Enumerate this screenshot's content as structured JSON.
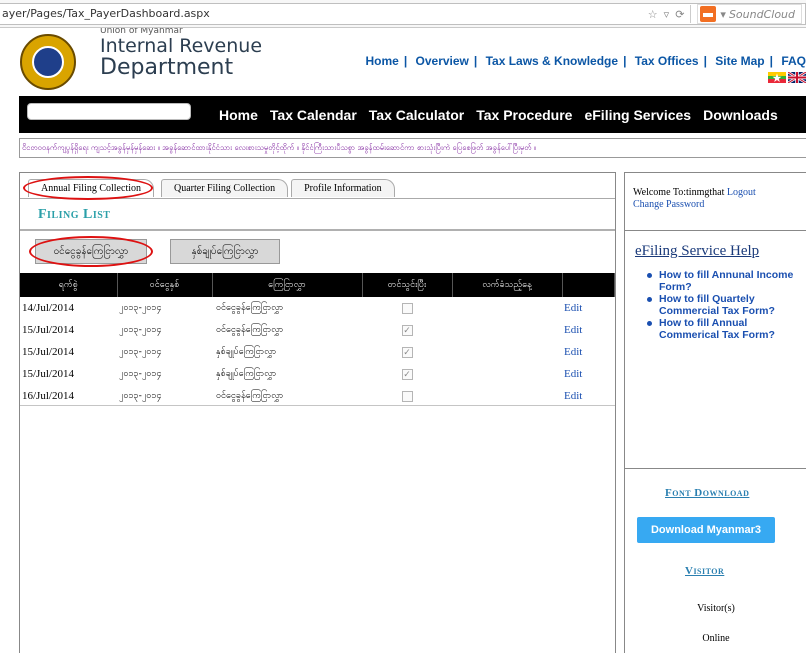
{
  "browser": {
    "url": "ayer/Pages/Tax_PayerDashboard.aspx",
    "search_engine": "SoundCloud"
  },
  "header": {
    "org_top": "Union of Myanmar",
    "org_line1": "Internal Revenue",
    "org_line2": "Department",
    "topnav": [
      "Home",
      "Overview",
      "Tax Laws & Knowledge",
      "Tax Offices",
      "Site Map",
      "FAQ"
    ]
  },
  "menu": {
    "items": [
      "Home",
      "Tax Calendar",
      "Tax Calculator",
      "Tax Procedure",
      "eFiling Services",
      "Downloads"
    ]
  },
  "marquee": "ငိငတဝဝနက်ကျပွန်ရှိရေး ကျသင့်အခွန်မှန်မှန်ဆေး ။ အခွန်ဆောင်ထားနိုင်ငံသား လေးစားသမှုတိုင့်ထိုက် ။ နိုင်ငံကြီးသားပီသစွာ အခွန်ထမ်းဆောင်ကာ စားသုံးပြီးကဲ ပြေစေဖြတ် အခွန်ပေါ်ပြီးမှတ် ။",
  "tabs": [
    "Annual Filing Collection",
    "Quarter Filing Collection",
    "Profile Information"
  ],
  "main": {
    "title": "Filing List",
    "btn_income": "ဝင်ငွေခွန်ကြေငြာလွှာ",
    "btn_commercial": "နှစ်ချုပ်ကြေငြာလွှာ"
  },
  "table": {
    "headers": [
      "ရက်စွဲ",
      "ဝင်ငွေနှစ်",
      "ကြေငြာလွှာ",
      "တင်သွင်းပြီး",
      "လက်ခံသည့်နေ့",
      ""
    ],
    "rows": [
      {
        "date": "14/Jul/2014",
        "year": "၂၀၁၃-၂၀၁၄",
        "type": "ဝင်ငွေခွန်ကြေငြာလွှာ",
        "submitted": false,
        "edit": "Edit"
      },
      {
        "date": "15/Jul/2014",
        "year": "၂၀၁၃-၂၀၁၄",
        "type": "ဝင်ငွေခွန်ကြေငြာလွှာ",
        "submitted": true,
        "edit": "Edit"
      },
      {
        "date": "15/Jul/2014",
        "year": "၂၀၁၃-၂၀၁၄",
        "type": "နှစ်ချုပ်ကြေငြာလွှာ",
        "submitted": true,
        "edit": "Edit"
      },
      {
        "date": "15/Jul/2014",
        "year": "၂၀၁၃-၂၀၁၄",
        "type": "နှစ်ချုပ်ကြေငြာလွှာ",
        "submitted": true,
        "edit": "Edit"
      },
      {
        "date": "16/Jul/2014",
        "year": "၂၀၁၃-၂၀၁၄",
        "type": "ဝင်ငွေခွန်ကြေငြာလွှာ",
        "submitted": false,
        "edit": "Edit"
      }
    ]
  },
  "welcome": {
    "text": "Welcome To:tinmgthat",
    "logout": "Logout",
    "change_password": "Change Password"
  },
  "help": {
    "title": "eFiling Service Help",
    "links": [
      "How to fill Annunal Income Form?",
      "How to fill Quartely Commercial Tax Form?",
      "How to fill Annual Commerical Tax Form?"
    ]
  },
  "font_download": {
    "title": "Font Download",
    "button": "Download Myanmar3"
  },
  "visitor": {
    "title": "Visitor",
    "line1": "Visitor(s)",
    "line2": "Online"
  },
  "colors": {
    "accent": "#2a9fa8",
    "link": "#1a4fb0",
    "menubar": "#000000",
    "download_button": "#37a9f2",
    "highlight_ellipse": "#dd1111"
  }
}
